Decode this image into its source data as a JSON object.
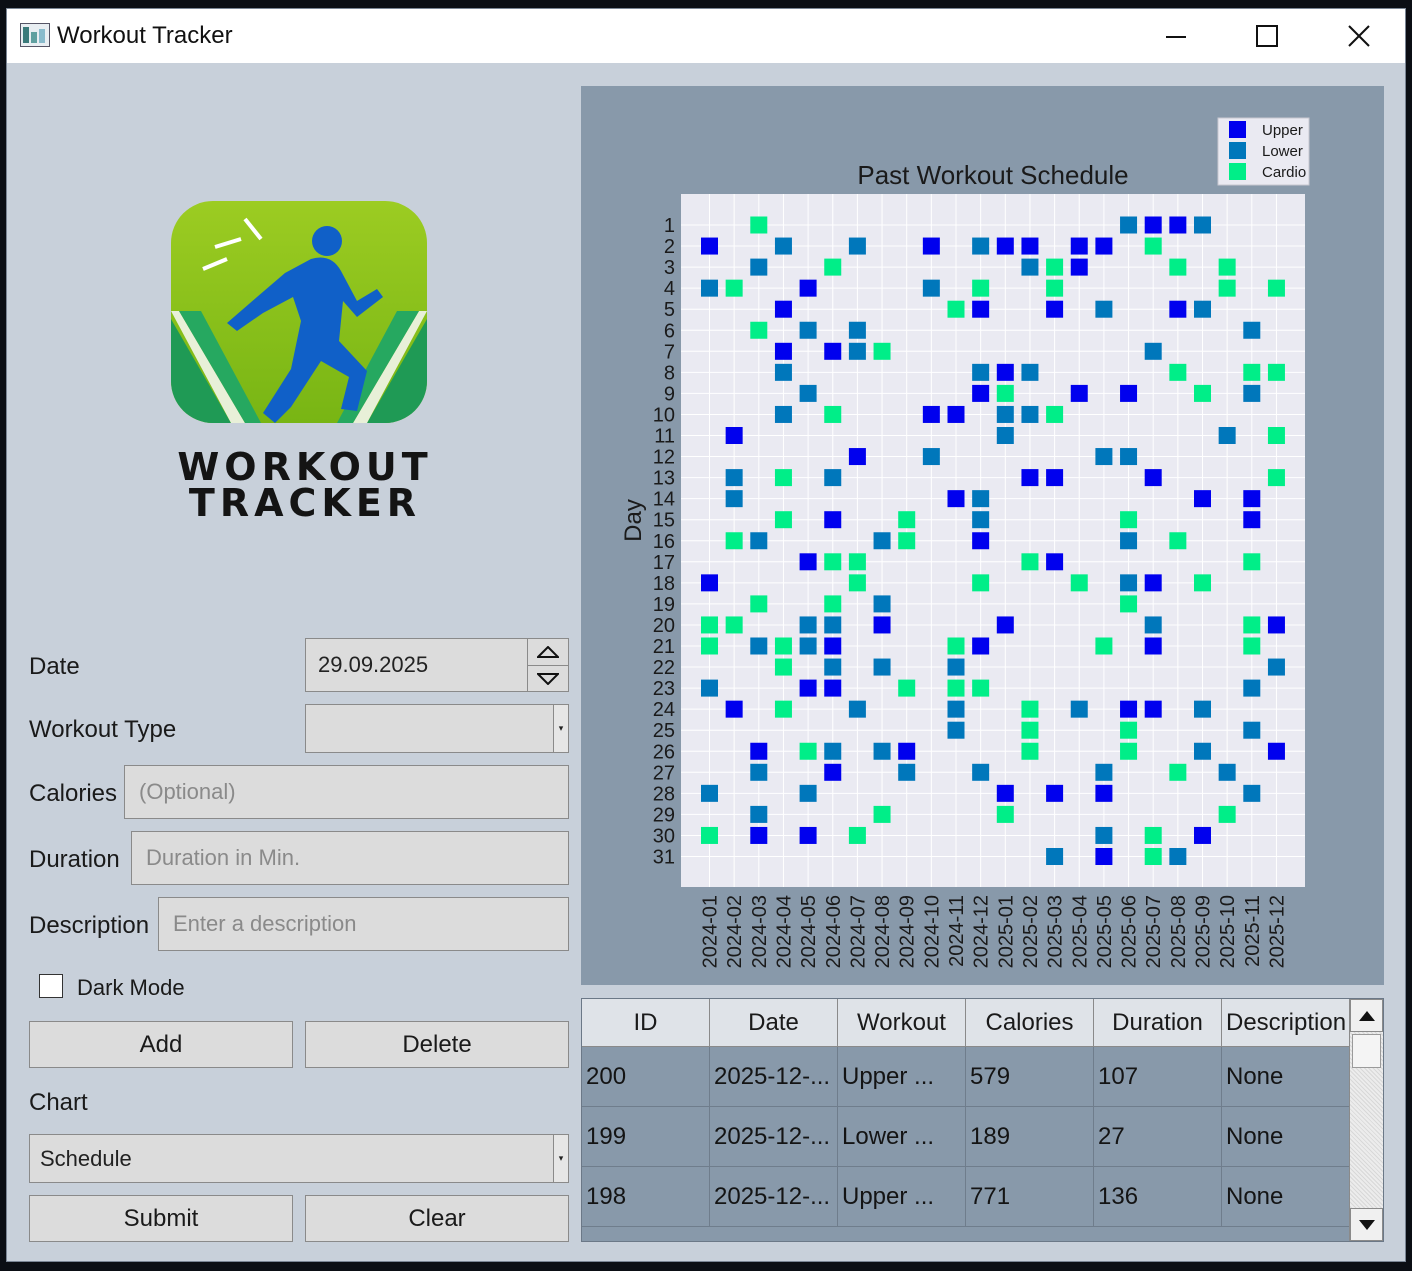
{
  "window": {
    "title": "Workout Tracker"
  },
  "logo": {
    "line1": "WORKOUT",
    "line2": "TRACKER"
  },
  "form": {
    "date_label": "Date",
    "date_value": "29.09.2025",
    "workout_type_label": "Workout Type",
    "workout_type_value": "",
    "calories_label": "Calories",
    "calories_placeholder": "(Optional)",
    "duration_label": "Duration",
    "duration_placeholder": "Duration in Min.",
    "description_label": "Description",
    "description_placeholder": "Enter a description",
    "dark_mode_label": "Dark Mode",
    "add_label": "Add",
    "delete_label": "Delete",
    "chart_label": "Chart",
    "chart_value": "Schedule",
    "submit_label": "Submit",
    "clear_label": "Clear"
  },
  "chart_data": {
    "type": "scatter",
    "title": "Past Workout Schedule",
    "xlabel": "",
    "ylabel": "Day",
    "x_categories": [
      "2024-01",
      "2024-02",
      "2024-03",
      "2024-04",
      "2024-05",
      "2024-06",
      "2024-07",
      "2024-08",
      "2024-09",
      "2024-10",
      "2024-11",
      "2024-12",
      "2025-01",
      "2025-02",
      "2025-03",
      "2025-04",
      "2025-05",
      "2025-06",
      "2025-07",
      "2025-08",
      "2025-09",
      "2025-10",
      "2025-11",
      "2025-12"
    ],
    "y_range": [
      1,
      31
    ],
    "legend_position": "top-right",
    "grid": true,
    "series": [
      {
        "name": "Upper",
        "color": "#0000ee",
        "points": [
          [
            "2024-01",
            2
          ],
          [
            "2024-01",
            18
          ],
          [
            "2024-02",
            11
          ],
          [
            "2024-02",
            24
          ],
          [
            "2024-03",
            26
          ],
          [
            "2024-03",
            30
          ],
          [
            "2024-04",
            5
          ],
          [
            "2024-04",
            7
          ],
          [
            "2024-05",
            4
          ],
          [
            "2024-05",
            17
          ],
          [
            "2024-05",
            23
          ],
          [
            "2024-05",
            30
          ],
          [
            "2024-06",
            7
          ],
          [
            "2024-06",
            15
          ],
          [
            "2024-06",
            21
          ],
          [
            "2024-06",
            23
          ],
          [
            "2024-06",
            27
          ],
          [
            "2024-07",
            12
          ],
          [
            "2024-08",
            20
          ],
          [
            "2024-09",
            26
          ],
          [
            "2024-10",
            2
          ],
          [
            "2024-10",
            10
          ],
          [
            "2024-11",
            10
          ],
          [
            "2024-11",
            14
          ],
          [
            "2024-12",
            5
          ],
          [
            "2024-12",
            9
          ],
          [
            "2024-12",
            16
          ],
          [
            "2024-12",
            21
          ],
          [
            "2025-01",
            2
          ],
          [
            "2025-01",
            8
          ],
          [
            "2025-01",
            20
          ],
          [
            "2025-01",
            28
          ],
          [
            "2025-02",
            2
          ],
          [
            "2025-02",
            13
          ],
          [
            "2025-03",
            5
          ],
          [
            "2025-03",
            13
          ],
          [
            "2025-03",
            17
          ],
          [
            "2025-03",
            28
          ],
          [
            "2025-04",
            2
          ],
          [
            "2025-04",
            3
          ],
          [
            "2025-04",
            9
          ],
          [
            "2025-05",
            2
          ],
          [
            "2025-05",
            28
          ],
          [
            "2025-05",
            31
          ],
          [
            "2025-06",
            9
          ],
          [
            "2025-06",
            24
          ],
          [
            "2025-07",
            1
          ],
          [
            "2025-07",
            13
          ],
          [
            "2025-07",
            18
          ],
          [
            "2025-07",
            21
          ],
          [
            "2025-07",
            24
          ],
          [
            "2025-08",
            1
          ],
          [
            "2025-08",
            5
          ],
          [
            "2025-09",
            14
          ],
          [
            "2025-09",
            30
          ],
          [
            "2025-11",
            14
          ],
          [
            "2025-11",
            15
          ],
          [
            "2025-12",
            20
          ],
          [
            "2025-12",
            26
          ]
        ]
      },
      {
        "name": "Lower",
        "color": "#0077bb",
        "points": [
          [
            "2024-01",
            4
          ],
          [
            "2024-01",
            23
          ],
          [
            "2024-01",
            28
          ],
          [
            "2024-02",
            13
          ],
          [
            "2024-02",
            14
          ],
          [
            "2024-03",
            3
          ],
          [
            "2024-03",
            16
          ],
          [
            "2024-03",
            21
          ],
          [
            "2024-03",
            27
          ],
          [
            "2024-03",
            29
          ],
          [
            "2024-04",
            2
          ],
          [
            "2024-04",
            8
          ],
          [
            "2024-04",
            10
          ],
          [
            "2024-05",
            6
          ],
          [
            "2024-05",
            9
          ],
          [
            "2024-05",
            20
          ],
          [
            "2024-05",
            21
          ],
          [
            "2024-05",
            28
          ],
          [
            "2024-06",
            13
          ],
          [
            "2024-06",
            20
          ],
          [
            "2024-06",
            22
          ],
          [
            "2024-06",
            26
          ],
          [
            "2024-07",
            2
          ],
          [
            "2024-07",
            6
          ],
          [
            "2024-07",
            7
          ],
          [
            "2024-07",
            24
          ],
          [
            "2024-08",
            16
          ],
          [
            "2024-08",
            19
          ],
          [
            "2024-08",
            22
          ],
          [
            "2024-08",
            26
          ],
          [
            "2024-09",
            27
          ],
          [
            "2024-10",
            4
          ],
          [
            "2024-10",
            12
          ],
          [
            "2024-11",
            22
          ],
          [
            "2024-11",
            24
          ],
          [
            "2024-11",
            25
          ],
          [
            "2024-12",
            2
          ],
          [
            "2024-12",
            8
          ],
          [
            "2024-12",
            14
          ],
          [
            "2024-12",
            15
          ],
          [
            "2024-12",
            27
          ],
          [
            "2025-01",
            10
          ],
          [
            "2025-01",
            11
          ],
          [
            "2025-02",
            3
          ],
          [
            "2025-02",
            8
          ],
          [
            "2025-02",
            10
          ],
          [
            "2025-03",
            31
          ],
          [
            "2025-04",
            24
          ],
          [
            "2025-05",
            5
          ],
          [
            "2025-05",
            12
          ],
          [
            "2025-05",
            27
          ],
          [
            "2025-05",
            30
          ],
          [
            "2025-06",
            1
          ],
          [
            "2025-06",
            12
          ],
          [
            "2025-06",
            16
          ],
          [
            "2025-06",
            18
          ],
          [
            "2025-07",
            7
          ],
          [
            "2025-07",
            20
          ],
          [
            "2025-08",
            31
          ],
          [
            "2025-09",
            1
          ],
          [
            "2025-09",
            5
          ],
          [
            "2025-09",
            24
          ],
          [
            "2025-09",
            26
          ],
          [
            "2025-10",
            11
          ],
          [
            "2025-10",
            27
          ],
          [
            "2025-11",
            6
          ],
          [
            "2025-11",
            9
          ],
          [
            "2025-11",
            23
          ],
          [
            "2025-11",
            25
          ],
          [
            "2025-11",
            28
          ],
          [
            "2025-12",
            22
          ]
        ]
      },
      {
        "name": "Cardio",
        "color": "#00ee88",
        "points": [
          [
            "2024-01",
            20
          ],
          [
            "2024-01",
            21
          ],
          [
            "2024-01",
            30
          ],
          [
            "2024-02",
            4
          ],
          [
            "2024-02",
            16
          ],
          [
            "2024-02",
            20
          ],
          [
            "2024-03",
            1
          ],
          [
            "2024-03",
            6
          ],
          [
            "2024-03",
            19
          ],
          [
            "2024-04",
            13
          ],
          [
            "2024-04",
            15
          ],
          [
            "2024-04",
            21
          ],
          [
            "2024-04",
            22
          ],
          [
            "2024-04",
            24
          ],
          [
            "2024-05",
            26
          ],
          [
            "2024-06",
            3
          ],
          [
            "2024-06",
            10
          ],
          [
            "2024-06",
            17
          ],
          [
            "2024-06",
            19
          ],
          [
            "2024-07",
            17
          ],
          [
            "2024-07",
            18
          ],
          [
            "2024-07",
            30
          ],
          [
            "2024-08",
            7
          ],
          [
            "2024-08",
            29
          ],
          [
            "2024-09",
            15
          ],
          [
            "2024-09",
            16
          ],
          [
            "2024-09",
            23
          ],
          [
            "2024-11",
            5
          ],
          [
            "2024-11",
            21
          ],
          [
            "2024-11",
            23
          ],
          [
            "2024-12",
            4
          ],
          [
            "2024-12",
            18
          ],
          [
            "2024-12",
            23
          ],
          [
            "2025-01",
            9
          ],
          [
            "2025-01",
            29
          ],
          [
            "2025-02",
            17
          ],
          [
            "2025-02",
            24
          ],
          [
            "2025-02",
            25
          ],
          [
            "2025-02",
            26
          ],
          [
            "2025-03",
            3
          ],
          [
            "2025-03",
            4
          ],
          [
            "2025-03",
            10
          ],
          [
            "2025-04",
            18
          ],
          [
            "2025-05",
            21
          ],
          [
            "2025-06",
            15
          ],
          [
            "2025-06",
            19
          ],
          [
            "2025-06",
            25
          ],
          [
            "2025-06",
            26
          ],
          [
            "2025-07",
            2
          ],
          [
            "2025-07",
            30
          ],
          [
            "2025-07",
            31
          ],
          [
            "2025-08",
            3
          ],
          [
            "2025-08",
            8
          ],
          [
            "2025-08",
            16
          ],
          [
            "2025-08",
            27
          ],
          [
            "2025-09",
            9
          ],
          [
            "2025-09",
            18
          ],
          [
            "2025-10",
            3
          ],
          [
            "2025-10",
            4
          ],
          [
            "2025-10",
            29
          ],
          [
            "2025-11",
            8
          ],
          [
            "2025-11",
            17
          ],
          [
            "2025-11",
            20
          ],
          [
            "2025-11",
            21
          ],
          [
            "2025-12",
            4
          ],
          [
            "2025-12",
            8
          ],
          [
            "2025-12",
            11
          ],
          [
            "2025-12",
            13
          ]
        ]
      }
    ]
  },
  "table": {
    "headers": [
      "ID",
      "Date",
      "Workout",
      "Calories",
      "Duration",
      "Description"
    ],
    "rows": [
      [
        "200",
        "2025-12-...",
        "Upper ...",
        "579",
        "107",
        "None"
      ],
      [
        "199",
        "2025-12-...",
        "Lower ...",
        "189",
        "27",
        "None"
      ],
      [
        "198",
        "2025-12-...",
        "Upper ...",
        "771",
        "136",
        "None"
      ]
    ]
  }
}
